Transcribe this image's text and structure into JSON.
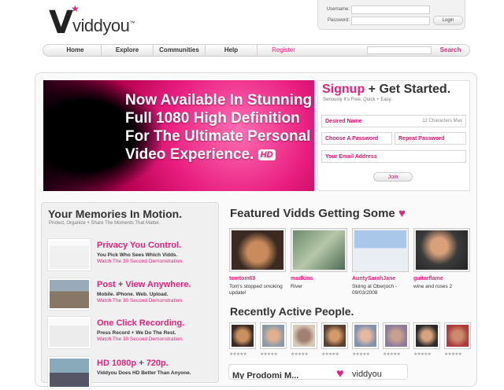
{
  "logo": {
    "letter": "V",
    "star": "★",
    "wordmark": "viddyou",
    "tm": "™"
  },
  "login": {
    "username_label": "Username:",
    "password_label": "Password:",
    "username_value": "",
    "password_value": "",
    "button": "Login"
  },
  "nav": {
    "items": [
      "Home",
      "Explore",
      "Communities",
      "Help",
      "Register"
    ],
    "search_value": "",
    "search_button": "Search"
  },
  "hero": {
    "text": "Now Available In Stunning Full 1080 High Definition For The Ultimate Personal Video Experience.",
    "badge": "HD"
  },
  "signup": {
    "title_pink": "Signup",
    "title_rest": " + Get Started.",
    "subtitle": "Seriously It's Free, Quick + Easy.",
    "fields": {
      "name": "Desired Name",
      "name_hint": "12 Characters Max",
      "password": "Choose A Password",
      "repeat": "Repeat Password",
      "email": "Your Email Address"
    },
    "join": "Join"
  },
  "memories": {
    "title": "Your Memories In Motion.",
    "subtitle": "Protect, Organize + Share The Moments That Matter.",
    "features": [
      {
        "h_pink": "Privacy You Control.",
        "h_plus": "",
        "h_pink2": "",
        "desc": "You Pick Who Sees Which Vidds.",
        "link": "Watch The 30 Second Demonstration."
      },
      {
        "h_pink": "Post",
        "h_plus": " + ",
        "h_pink2": "View Anywhere.",
        "desc": "Mobile. iPhone. Web. Upload.",
        "link": "Watch The 30 Second Demonstration."
      },
      {
        "h_pink": "One Click Recording.",
        "h_plus": "",
        "h_pink2": "",
        "desc": "Press Record + We Do The Rest.",
        "link": "Watch The 30 Second Demonstration."
      },
      {
        "h_pink": "HD 1080p",
        "h_plus": " + ",
        "h_pink2": "720p.",
        "desc": "Viddyou Does HD Better Than Anyone.",
        "link": ""
      }
    ]
  },
  "featured": {
    "title": "Featured Vidds Getting Some",
    "heart": "♥",
    "vidds": [
      {
        "user": "tomtom69",
        "desc": "Tom's stopped smoking update!"
      },
      {
        "user": "madkins",
        "desc": "River"
      },
      {
        "user": "AuntySarahJane",
        "desc": "Skiing at Oberjoch - 09/03/2008"
      },
      {
        "user": "guitarflame",
        "desc": "wine and roses 2"
      }
    ]
  },
  "recent": {
    "title": "Recently Active People.",
    "stars": "★★★★★",
    "count": 8
  },
  "promo": {
    "title": "My Prodomi M...",
    "heart": "♥",
    "wordmark": "viddyou"
  },
  "colors": {
    "accent": "#e2237d",
    "text": "#333333"
  }
}
